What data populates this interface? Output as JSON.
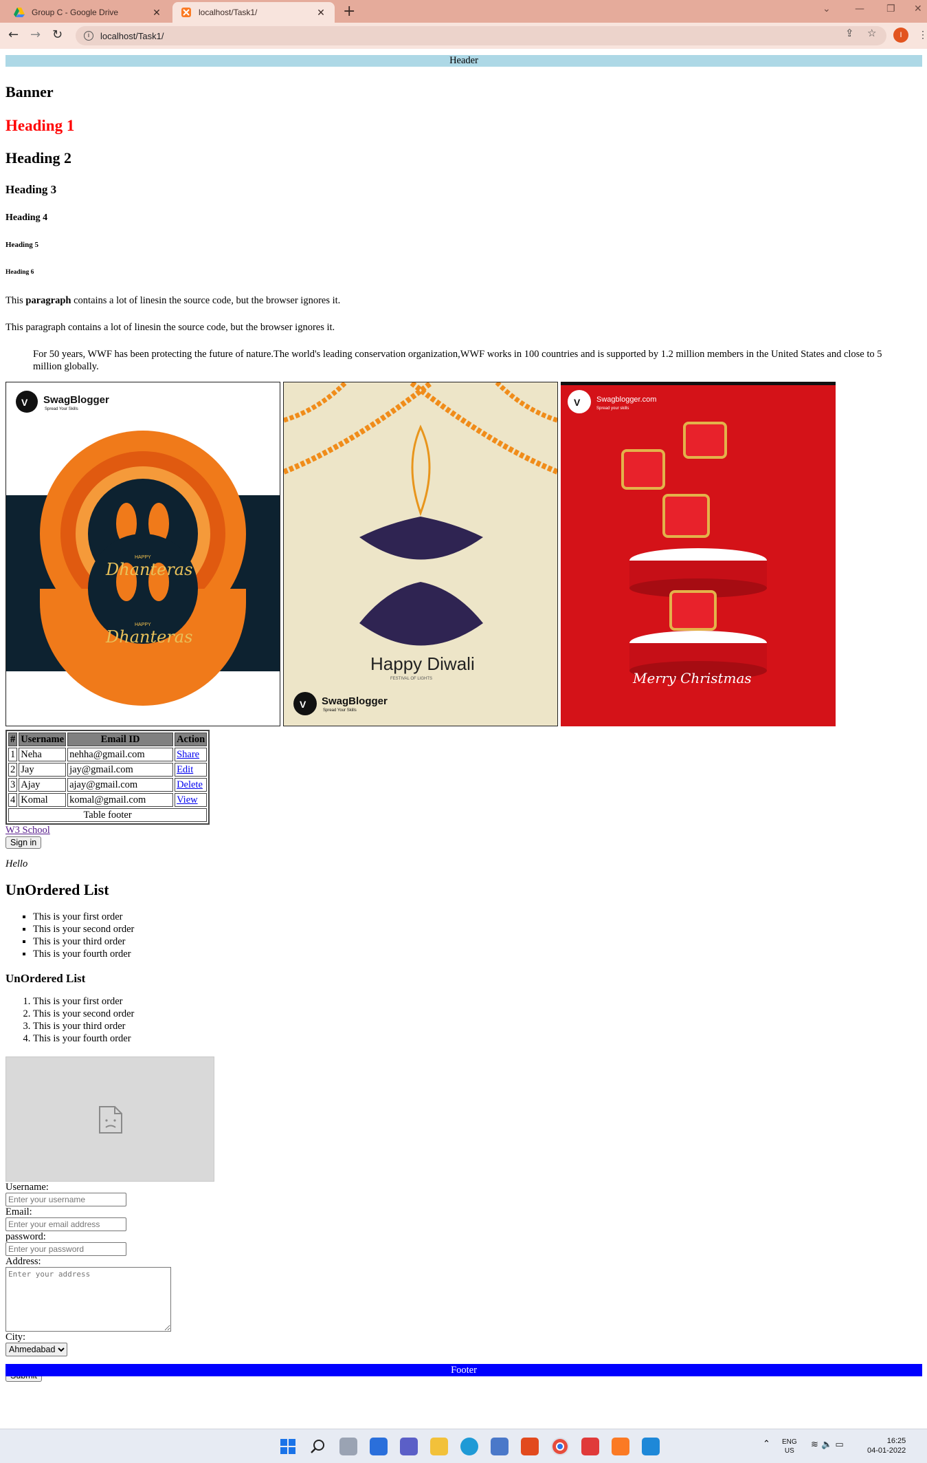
{
  "browser": {
    "tabs": [
      {
        "title": "Group C - Google Drive",
        "active": false
      },
      {
        "title": "localhost/Task1/",
        "active": true
      }
    ],
    "url": "localhost/Task1/",
    "profile_initial": "I"
  },
  "page": {
    "header": "Header",
    "banner": "Banner",
    "headings": [
      "Heading 1",
      "Heading 2",
      "Heading 3",
      "Heading 4",
      "Heading 5",
      "Heading 6"
    ],
    "paragraph1": {
      "prefix": "This ",
      "bold": "paragraph",
      "suffix": " contains a lot of linesin the source code, but the browser ignores it."
    },
    "paragraph2": "This paragraph contains a lot of linesin the source code, but the browser ignores it.",
    "blockquote": "For 50 years, WWF has been protecting the future of nature.The world's leading conservation organization,WWF works in 100 countries and is supported by 1.2 million members in the United States and close to 5 million globally.",
    "gallery": [
      {
        "brand": "SwagBlogger",
        "tagline": "Spread Your Skills",
        "small": "HAPPY",
        "title": "Dhanteras"
      },
      {
        "title": "Happy Diwali",
        "subtitle": "FESTIVAL OF LIGHTS",
        "brand": "SwagBlogger",
        "tagline": "Spread Your Skills"
      },
      {
        "brand": "Swagblogger.com",
        "tagline": "Spread your skills",
        "title": "Merry Christmas"
      }
    ],
    "table": {
      "headers": [
        "#",
        "Username",
        "Email ID",
        "Action"
      ],
      "rows": [
        {
          "num": "1",
          "username": "Neha",
          "email": "nehha@gmail.com",
          "action": "Share"
        },
        {
          "num": "2",
          "username": "Jay",
          "email": "jay@gmail.com",
          "action": "Edit"
        },
        {
          "num": "3",
          "username": "Ajay",
          "email": "ajay@gmail.com",
          "action": "Delete"
        },
        {
          "num": "4",
          "username": "Komal",
          "email": "komal@gmail.com",
          "action": "View"
        }
      ],
      "footer": "Table footer"
    },
    "link": "W3 School",
    "signin_button": "Sign in",
    "hello": "Hello",
    "unordered_title": "UnOrdered List",
    "unordered_items": [
      "This is your first order",
      "This is your second order",
      "This is your third order",
      "This is your fourth order"
    ],
    "ordered_title": "UnOrdered List",
    "ordered_items": [
      "This is your first order",
      "This is your second order",
      "This is your third order",
      "This is your fourth order"
    ],
    "form": {
      "username_label": "Username:",
      "username_placeholder": "Enter your username",
      "email_label": "Email:",
      "email_placeholder": "Enter your email address",
      "password_label": "password:",
      "password_placeholder": "Enter your password",
      "address_label": "Address:",
      "address_placeholder": "Enter your address",
      "city_label": "City:",
      "city_value": "Ahmedabad",
      "submit": "Submit"
    },
    "footer": "Footer"
  },
  "taskbar": {
    "lang": "ENG",
    "region": "US",
    "time": "16:25",
    "date": "04-01-2022"
  },
  "colors": {
    "header_bg": "#add8e6",
    "footer_bg": "#0000ff",
    "heading1": "#ff0000",
    "tabbar": "#e5ab9b",
    "toolbar": "#f8e4dd"
  }
}
